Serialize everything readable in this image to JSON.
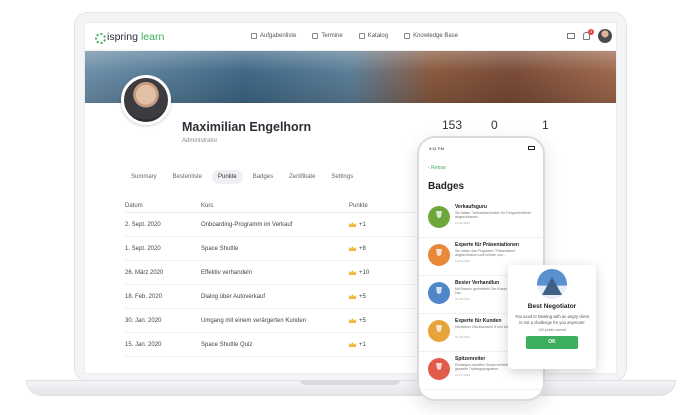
{
  "nav": {
    "logo_brand": "ispring",
    "logo_product": "learn",
    "links": [
      {
        "label": "Aufgabenliste",
        "icon": "list-icon"
      },
      {
        "label": "Termine",
        "icon": "calendar-icon"
      },
      {
        "label": "Katalog",
        "icon": "catalog-icon"
      },
      {
        "label": "Knowledge Base",
        "icon": "book-icon"
      }
    ],
    "notification_count": "3"
  },
  "profile": {
    "name": "Maximilian Engelhorn",
    "role": "Administrator",
    "stats": [
      "153",
      "0",
      "1"
    ]
  },
  "tabs": [
    "Summary",
    "Bestenliste",
    "Punkte",
    "Badges",
    "Zertifikate",
    "Settings"
  ],
  "table": {
    "headers": [
      "Datum",
      "Kurs",
      "Punkte"
    ],
    "rows": [
      {
        "date": "2. Sept. 2020",
        "course": "Onboarding-Programm im Verkauf",
        "points": "+1"
      },
      {
        "date": "1. Sept. 2020",
        "course": "Space Shuttle",
        "points": "+8"
      },
      {
        "date": "26. März 2020",
        "course": "Effektiv verhandeln",
        "points": "+10"
      },
      {
        "date": "18. Feb. 2020",
        "course": "Dialog über Autoverkauf",
        "points": "+5"
      },
      {
        "date": "30. Jan. 2020",
        "course": "Umgang mit einem verärgerten Kunden",
        "points": "+5"
      },
      {
        "date": "15. Jan. 2020",
        "course": "Space Shuttle Quiz",
        "points": "+1"
      }
    ]
  },
  "phone": {
    "time": "9:41 PM",
    "back": "‹ Retour",
    "title": "Badges",
    "badges": [
      {
        "name": "Verkaufsguru",
        "desc": "Sie haben \"Verkaufstechniken für Fortgeschrittene\" abgeschlossen.",
        "date": "13.05.2024",
        "color": "#6fa83a"
      },
      {
        "name": "Experte für Präsentationen",
        "desc": "Sie haben das Programm \"Präsentation\" abgeschlossen und können nun...",
        "date": "12.06.2024",
        "color": "#e8893a"
      },
      {
        "name": "Bester Verhandlun",
        "desc": "Mit Bravour gemeistert! Der Kunde ist mit Ihr keine Har...",
        "date": "02.06.2024",
        "color": "#4f86c9"
      },
      {
        "name": "Experte für Kunden",
        "desc": "Herzlichen Glückwunsch! S und können nun jede...",
        "date": "03.06.2024",
        "color": "#e8a43a"
      },
      {
        "name": "Spitzenreiter",
        "desc": "Einsteigen-schaffen Tempel erhöht! Sie haben das gesamte Trainingsprogramm...",
        "date": "01.07.2024",
        "color": "#e25a4a"
      }
    ]
  },
  "popup": {
    "title": "Best Negotiator",
    "desc": "You aced it! Dealing with an angry client is not a challenge for you anymore!",
    "points": "100 points earned",
    "button": "OK"
  },
  "colors": {
    "accent": "#3dae5e",
    "badge_red": "#e2443c"
  }
}
